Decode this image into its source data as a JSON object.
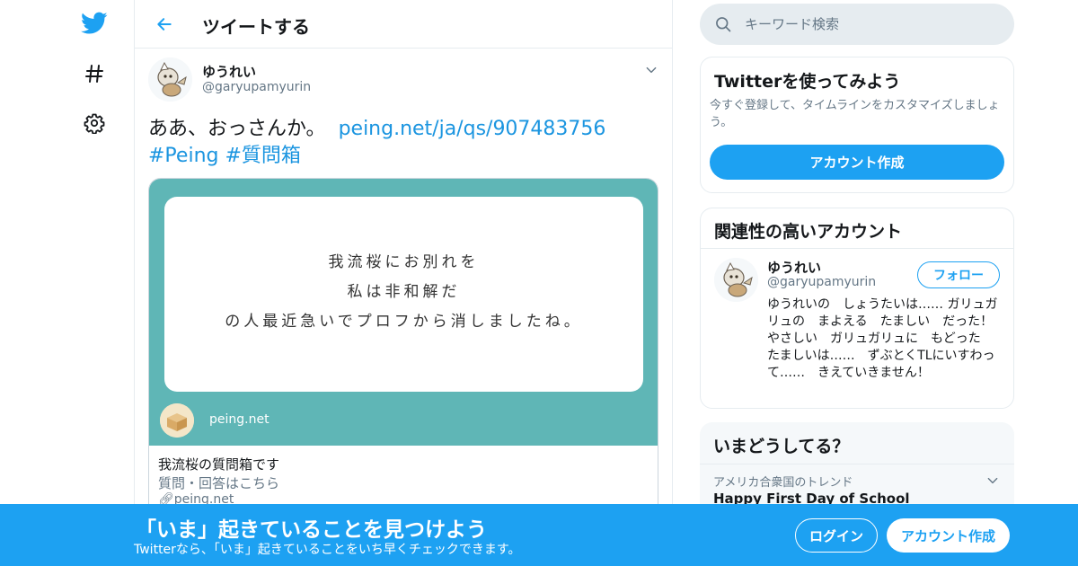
{
  "colors": {
    "accent": "#1da1f2",
    "link": "#1b95e0",
    "card_bg": "#5fb6b6",
    "text_primary": "#14171a",
    "text_secondary": "#657786",
    "border": "#e6ecf0"
  },
  "left_nav": {
    "items": [
      {
        "name": "twitter-logo-icon"
      },
      {
        "name": "hashtag-icon"
      },
      {
        "name": "gear-icon"
      }
    ]
  },
  "header": {
    "back_icon": "arrow-left-icon",
    "title": "ツイートする"
  },
  "tweet": {
    "author": {
      "name": "ゆうれい",
      "handle": "@garyupamyurin"
    },
    "text": "ああ、おっさんか。",
    "link": "peing.net/ja/qs/907483756",
    "hashtags": [
      "#Peing",
      "#質問箱"
    ],
    "card": {
      "image_lines": [
        "我流桜にお別れを",
        "私は非和解だ",
        "の人最近急いでプロフから消しましたね。"
      ],
      "image_brand": "peing.net",
      "title": "我流桜の質問箱です",
      "description": "質問・回答はこちら",
      "domain": "peing.net"
    }
  },
  "search": {
    "placeholder": "キーワード検索"
  },
  "signup_panel": {
    "title": "Twitterを使ってみよう",
    "subtitle": "今すぐ登録して、タイムラインをカスタマイズしましょう。",
    "button_label": "アカウント作成"
  },
  "related_panel": {
    "title": "関連性の高いアカウント",
    "account": {
      "name": "ゆうれい",
      "handle": "@garyupamyurin",
      "follow_label": "フォロー",
      "bio": "ゆうれいの　しょうたいは…… ガリュガリュの　まよえる　たましい　だった！ やさしい　ガリュガリュに　もどった　たましいは……　ずぶとくTLにいすわって……　きえていきません！"
    }
  },
  "trends_panel": {
    "title": "いまどうしてる？",
    "items": [
      {
        "context": "アメリカ合衆国のトレンド",
        "name": "Happy First Day of School"
      }
    ]
  },
  "bottom_bar": {
    "headline": "「いま」起きていることを見つけよう",
    "subtitle": "Twitterなら、「いま」起きていることをいち早くチェックできます。",
    "login_label": "ログイン",
    "signup_label": "アカウント作成"
  }
}
